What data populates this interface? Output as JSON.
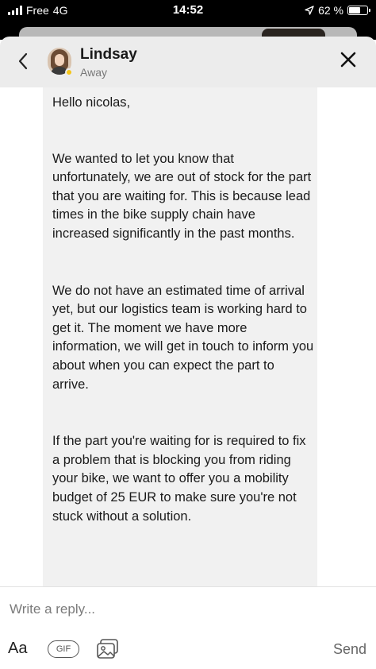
{
  "status_bar": {
    "carrier": "Free",
    "network": "4G",
    "time": "14:52",
    "battery_percent": "62 %",
    "battery_level": 0.62,
    "icons": [
      "signal-icon",
      "location-arrow-icon",
      "battery-icon"
    ]
  },
  "header": {
    "contact_name": "Lindsay",
    "contact_status": "Away",
    "presence_color": "#f5c518",
    "icons": [
      "chevron-left-icon",
      "close-icon"
    ]
  },
  "message": {
    "greeting": "Hello nicolas,",
    "paragraph_1": "We wanted to let you know that unfortunately, we are out of stock for the part that you are waiting for. This is because lead times in the bike supply chain have increased significantly in the past months.",
    "paragraph_2": "We do not have an estimated time of arrival yet, but our logistics team is working hard to get it. The moment we have more information, we will get in touch to inform you about when you can expect the part to arrive.",
    "paragraph_3": "If the part you're waiting for is required to fix a problem that is blocking you from riding your bike, we want to offer you a mobility budget of 25 EUR to make sure you're not stuck without a solution."
  },
  "composer": {
    "placeholder": "Write a reply...",
    "format_label": "Aa",
    "gif_label": "GIF",
    "send_label": "Send",
    "icons": [
      "photo-icon"
    ]
  }
}
